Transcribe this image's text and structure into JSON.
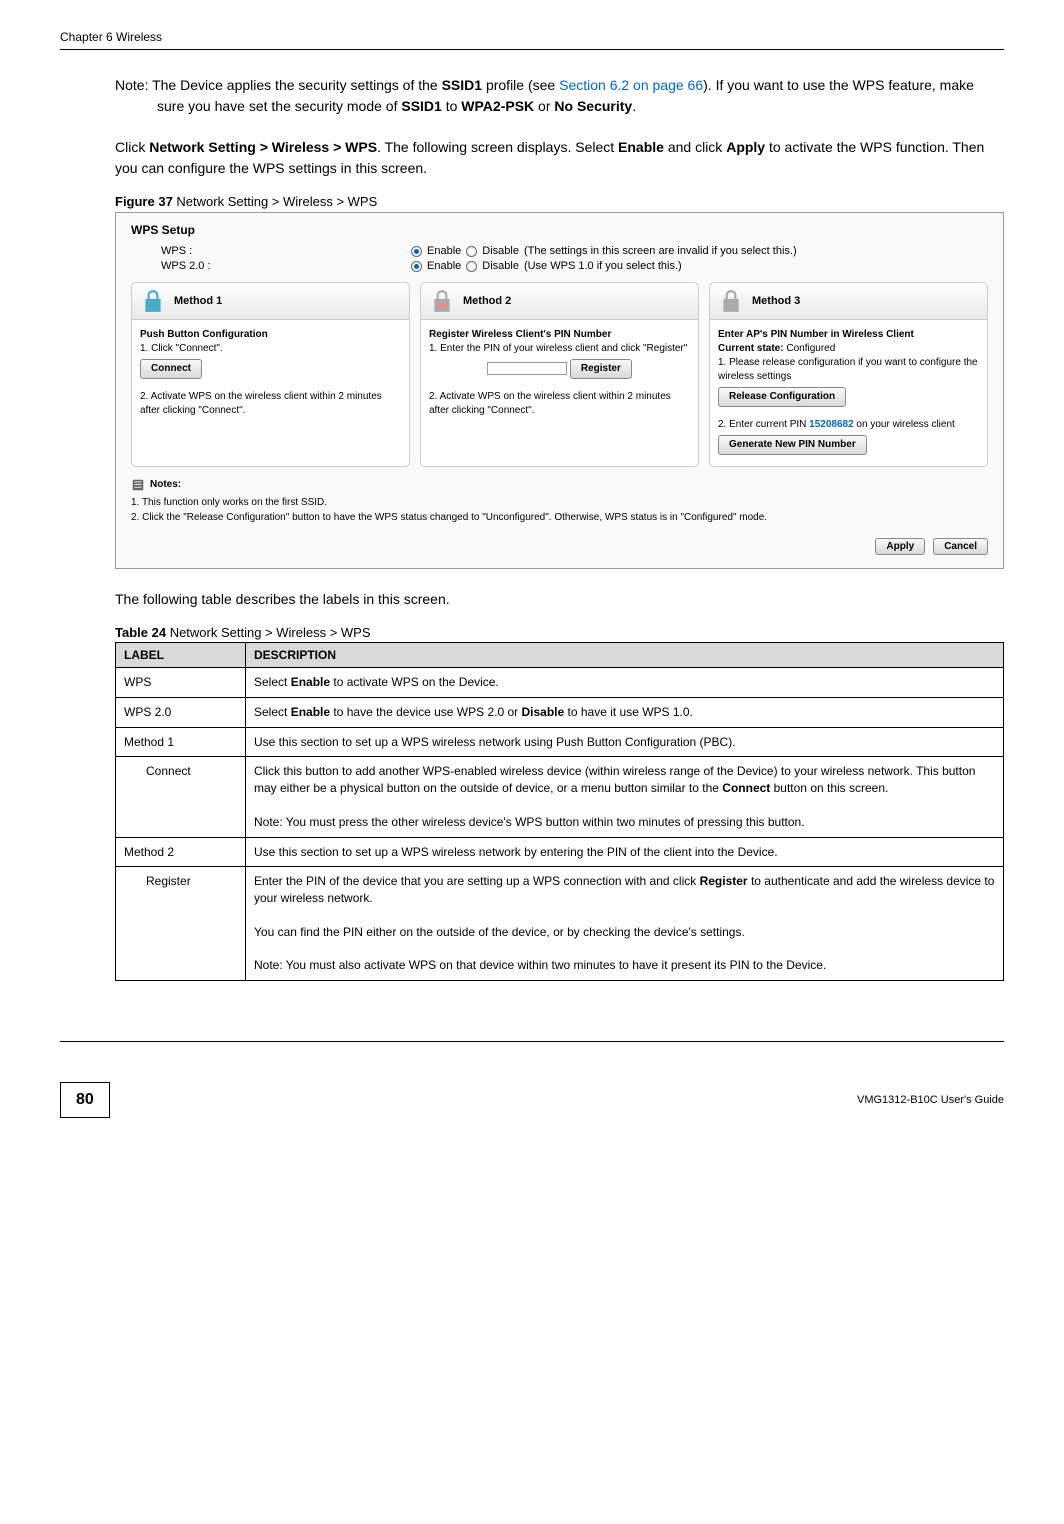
{
  "header": {
    "chapter": "Chapter 6 Wireless"
  },
  "note": {
    "prefix": "Note: The Device applies the security settings of the ",
    "ssid": "SSID1",
    "mid1": " profile (see ",
    "link": "Section 6.2 on page 66",
    "mid2": "). If you want to use the WPS feature, make sure you have set the security mode of ",
    "ssid2": "SSID1",
    "mid3": " to ",
    "wpa": "WPA2-PSK",
    "mid4": " or ",
    "nosec": "No Security",
    "end": "."
  },
  "body1": {
    "part1": "Click ",
    "nav": "Network Setting > Wireless > WPS",
    "part2": ". The following screen displays. Select ",
    "enable": "Enable",
    "part3": " and click ",
    "apply": "Apply",
    "part4": " to activate the WPS function. Then you can configure the WPS settings in this screen."
  },
  "figCaption": {
    "bold": "Figure 37   ",
    "text": "Network Setting > Wireless > WPS"
  },
  "screenshot": {
    "setupTitle": "WPS Setup",
    "wpsLabel": "WPS :",
    "wps20Label": "WPS 2.0 :",
    "enableText": "Enable",
    "disableText": "Disable",
    "wpsNote": " (The settings in this screen are invalid if you select this.)",
    "wps20Note": " (Use WPS 1.0 if you select this.)",
    "method1": {
      "title": "Method 1",
      "subtitle": "Push Button Configuration",
      "step1": "1. Click \"Connect\".",
      "connectBtn": "Connect",
      "step2": "2. Activate WPS on the wireless client within 2 minutes after clicking \"Connect\"."
    },
    "method2": {
      "title": "Method 2",
      "subtitle": "Register Wireless Client's PIN Number",
      "step1": "1. Enter the PIN of your wireless client and click \"Register\"",
      "registerBtn": "Register",
      "step2": "2. Activate WPS on the wireless client within 2 minutes after clicking \"Connect\"."
    },
    "method3": {
      "title": "Method 3",
      "subtitle": "Enter AP's PIN Number in Wireless Client",
      "state": "Current state: ",
      "stateVal": "Configured",
      "step1": "1. Please release configuration if you want to configure the wireless settings",
      "releaseBtn": "Release Configuration",
      "step2a": "2. Enter current PIN ",
      "pin": "15208682",
      "step2b": " on your wireless client",
      "genBtn": "Generate New PIN Number"
    },
    "notes": {
      "title": "Notes:",
      "n1": "1. This function only works on the first SSID.",
      "n2": "2. Click the \"Release Configuration\" button to have the WPS status changed to \"Unconfigured\". Otherwise, WPS status is in \"Configured\" mode."
    },
    "applyBtn": "Apply",
    "cancelBtn": "Cancel"
  },
  "body2": "The following table describes the labels in this screen.",
  "tableCaption": {
    "bold": "Table 24   ",
    "text": "Network Setting > Wireless > WPS"
  },
  "table": {
    "h1": "LABEL",
    "h2": "DESCRIPTION",
    "rows": [
      {
        "label": "WPS",
        "desc": "Select <b>Enable</b> to activate WPS on the Device."
      },
      {
        "label": "WPS 2.0",
        "desc": "Select <b>Enable</b> to have the device use WPS 2.0 or <b>Disable</b> to have it use WPS 1.0."
      },
      {
        "label": "Method 1",
        "desc": "Use this section to set up a WPS wireless network using Push Button Configuration (PBC)."
      },
      {
        "label": "Connect",
        "indent": true,
        "desc": "Click this button to add another WPS-enabled wireless device (within wireless range of the Device) to your wireless network. This button may either be a physical button on the outside of device, or a menu button similar to the <b>Connect</b> button on this screen.<br><br>Note: You must press the other wireless device's WPS button within two minutes of pressing this button."
      },
      {
        "label": "Method 2",
        "desc": "Use this section to set up a WPS wireless network by entering the PIN of the client into the Device."
      },
      {
        "label": "Register",
        "indent": true,
        "desc": "Enter the PIN of the device that you are setting up a WPS connection with and click <b>Register</b> to authenticate and add the wireless device to your wireless network.<br><br>You can find the PIN either on the outside of the device, or by checking the device's settings.<br><br>Note: You must also activate WPS on that device within two minutes to have it present its PIN to the Device."
      }
    ]
  },
  "footer": {
    "pageNum": "80",
    "guide": "VMG1312-B10C User's Guide"
  }
}
